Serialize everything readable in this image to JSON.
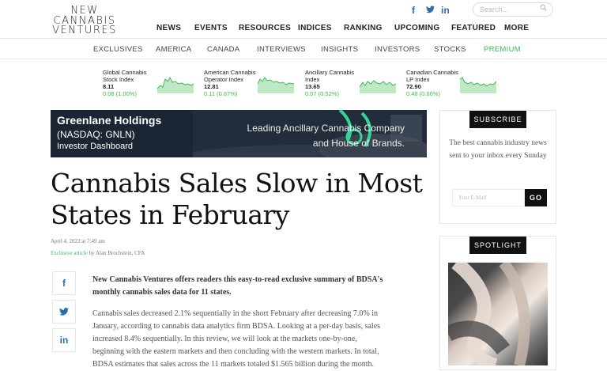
{
  "logo": {
    "line1": "NEW",
    "line2": "CANNABIS",
    "line3": "VENTURES"
  },
  "social": {
    "facebook": "f",
    "twitter": "t",
    "linkedin": "in"
  },
  "search": {
    "placeholder": "Search..."
  },
  "main_nav": [
    "NEWS",
    "EVENTS",
    "RESOURCES",
    "INDICES",
    "RANKING",
    "UPCOMING",
    "FEATURED",
    "MORE"
  ],
  "sub_nav": [
    "EXCLUSIVES",
    "AMERICA",
    "CANADA",
    "INTERVIEWS",
    "INSIGHTS",
    "INVESTORS",
    "STOCKS",
    "PREMIUM"
  ],
  "indices": [
    {
      "name1": "Global Cannabis",
      "name2": "Stock Index",
      "value": "8.11",
      "change": "0.08 (1.00%)"
    },
    {
      "name1": "American Cannabis",
      "name2": "Operator Index",
      "value": "12.81",
      "change": "0.11 (0.87%)"
    },
    {
      "name1": "Ancillary Cannabis",
      "name2": "Index",
      "value": "13.65",
      "change": "0.07 (0.52%)"
    },
    {
      "name1": "Canadian Cannabis",
      "name2": "LP Index",
      "value": "72.90",
      "change": "0.48 (0.66%)"
    }
  ],
  "banner": {
    "company": "Greenlane Holdings",
    "ticker": "(NASDAQ: GNLN)",
    "dashboard": "Investor Dashboard",
    "tagline1": "Leading Ancillary Cannabis Company",
    "tagline2": "and House of Brands."
  },
  "article": {
    "title_line1": "Cannabis Sales Slow in Most",
    "title_line2": "States in February",
    "date": "April 4, 2023 at 7:49 am",
    "exclusive": "Exclusive article",
    "byline": " by Alan Brochstein, CFA",
    "lead": "New Cannabis Ventures offers readers this easy-to-read exclusive summary of BDSA's monthly cannabis sales data for 11 states.",
    "body": "Cannabis sales decreased 2.1% sequentially in  the short February after decreasing 7.0% in January, according to cannabis data analytics firm BDSA. Looking at a per-day basis, sales increased 8.4% sequentially. In this review, we will look at the markets one-by-one, beginning with the eastern markets and then concluding with the western markets. In total, BDSA estimates that sales across the 11 markets totaled $1.565 billion during the month."
  },
  "sidebar": {
    "subscribe_title": "SUBSCRIBE",
    "subscribe_text": "The best cannabis industry news sent to your inbox every Sunday",
    "email_placeholder": "Your E-Mail",
    "go_label": "GO",
    "spotlight_title": "SPOTLIGHT"
  },
  "colors": {
    "accent_green": "#3cba54",
    "social_blue": "#2b6cb0",
    "banner_bg": "#1c2533"
  }
}
